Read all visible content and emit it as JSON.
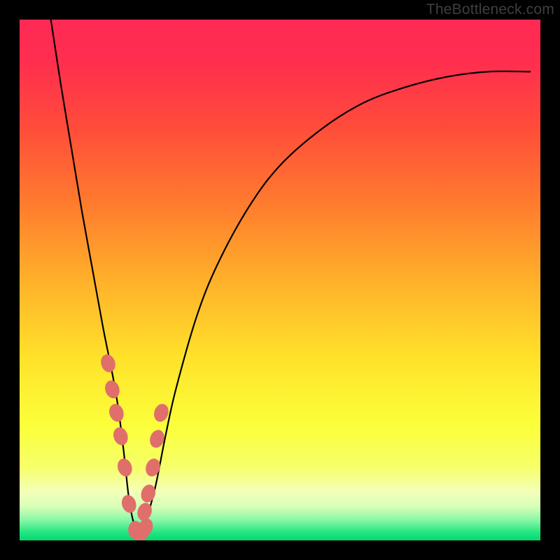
{
  "watermark": {
    "text": "TheBottleneck.com"
  },
  "colors": {
    "frame": "#000000",
    "curve_stroke": "#000000",
    "marker_fill": "#e06f6b",
    "marker_stroke": "#c95752",
    "gradient_stops": [
      {
        "offset": 0.0,
        "color": "#ff2a55"
      },
      {
        "offset": 0.08,
        "color": "#ff2e4f"
      },
      {
        "offset": 0.2,
        "color": "#ff4a3b"
      },
      {
        "offset": 0.35,
        "color": "#ff7a2e"
      },
      {
        "offset": 0.5,
        "color": "#ffb02a"
      },
      {
        "offset": 0.65,
        "color": "#ffe22a"
      },
      {
        "offset": 0.78,
        "color": "#fbff3a"
      },
      {
        "offset": 0.86,
        "color": "#f6ff6a"
      },
      {
        "offset": 0.905,
        "color": "#f4ffb8"
      },
      {
        "offset": 0.935,
        "color": "#d8ffb8"
      },
      {
        "offset": 0.96,
        "color": "#8cf7a8"
      },
      {
        "offset": 0.985,
        "color": "#22e581"
      },
      {
        "offset": 1.0,
        "color": "#00d973"
      }
    ]
  },
  "chart_data": {
    "type": "line",
    "title": "",
    "xlabel": "",
    "ylabel": "",
    "xlim": [
      0,
      100
    ],
    "ylim": [
      0,
      100
    ],
    "grid": false,
    "series": [
      {
        "name": "bottleneck-curve",
        "x": [
          6,
          8,
          10,
          12,
          14,
          16,
          18,
          19,
          20,
          21,
          22,
          23,
          24,
          26,
          28,
          30,
          34,
          38,
          44,
          50,
          58,
          66,
          74,
          82,
          90,
          98
        ],
        "y": [
          100,
          87,
          75,
          63,
          52,
          41,
          31,
          25,
          17,
          8,
          3,
          1,
          3,
          10,
          20,
          29,
          43,
          53,
          64,
          72,
          79,
          84,
          87,
          89,
          90,
          90
        ]
      }
    ],
    "markers": {
      "name": "highlighted-points",
      "x": [
        17.0,
        17.8,
        18.6,
        19.4,
        20.2,
        21.0,
        22.2,
        23.4,
        24.2,
        24.0,
        24.7,
        25.6,
        26.4,
        27.2
      ],
      "y": [
        34.0,
        29.0,
        24.5,
        20.0,
        14.0,
        7.0,
        2.0,
        1.5,
        2.5,
        5.5,
        9.0,
        14.0,
        19.5,
        24.5
      ]
    },
    "note": "x and y are in percent of the plot area; y=0 is the bottom (green), y=100 is the top (red). The curve shows a V-shaped bottleneck dip near x≈22 reaching y≈1, rising asymptotically toward y≈90 on the right."
  }
}
